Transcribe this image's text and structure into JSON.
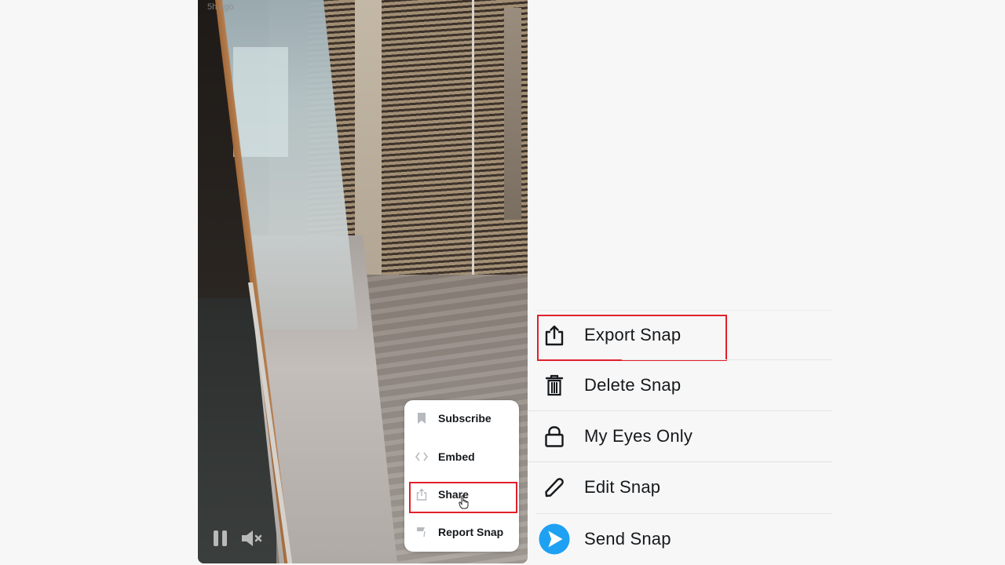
{
  "video": {
    "timestamp": "5h ago",
    "controls": {
      "pause_icon": "pause-icon",
      "mute_icon": "muted-speaker-icon"
    },
    "popup_menu": {
      "items": [
        {
          "label": "Subscribe",
          "icon": "bookmark-icon"
        },
        {
          "label": "Embed",
          "icon": "code-brackets-icon"
        },
        {
          "label": "Share",
          "icon": "share-upload-icon",
          "highlighted": true
        },
        {
          "label": "Report Snap",
          "icon": "flag-icon"
        }
      ]
    }
  },
  "snap_menu": {
    "items": [
      {
        "label": "Export Snap",
        "icon": "export-icon",
        "highlighted": true
      },
      {
        "label": "Delete Snap",
        "icon": "trash-icon"
      },
      {
        "label": "My Eyes Only",
        "icon": "lock-icon"
      },
      {
        "label": "Edit Snap",
        "icon": "pencil-icon"
      },
      {
        "label": "Send Snap",
        "icon": "send-arrow-icon"
      }
    ]
  },
  "colors": {
    "highlight_border": "#e2202c",
    "send_button": "#1ea1f2",
    "text": "#16191c"
  }
}
